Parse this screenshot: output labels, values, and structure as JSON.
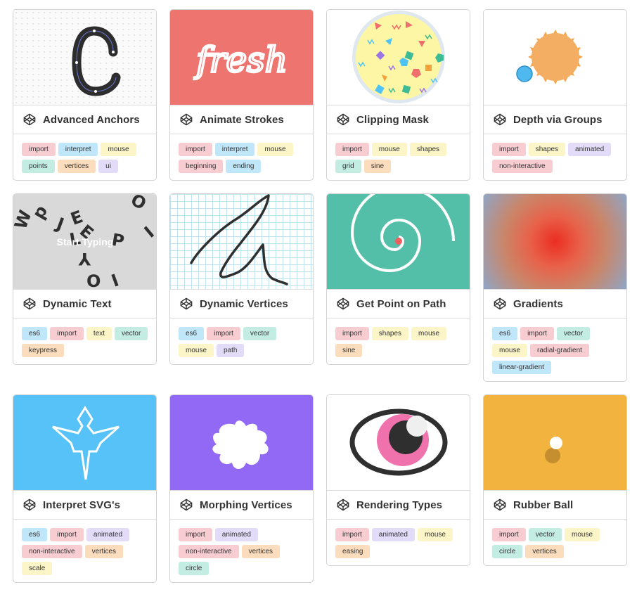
{
  "cards": [
    {
      "title": "Advanced Anchors",
      "tags": [
        "import",
        "interpret",
        "mouse",
        "points",
        "vertices",
        "ui"
      ]
    },
    {
      "title": "Animate Strokes",
      "tags": [
        "import",
        "interpret",
        "mouse",
        "beginning",
        "ending"
      ],
      "art_text": "fresh"
    },
    {
      "title": "Clipping Mask",
      "tags": [
        "import",
        "mouse",
        "shapes",
        "grid",
        "sine"
      ]
    },
    {
      "title": "Depth via Groups",
      "tags": [
        "import",
        "shapes",
        "animated",
        "non-interactive"
      ]
    },
    {
      "title": "Dynamic Text",
      "tags": [
        "es6",
        "import",
        "text",
        "vector",
        "keypress"
      ],
      "art_text": "Start Typing"
    },
    {
      "title": "Dynamic Vertices",
      "tags": [
        "es6",
        "import",
        "vector",
        "mouse",
        "path"
      ]
    },
    {
      "title": "Get Point on Path",
      "tags": [
        "import",
        "shapes",
        "mouse",
        "sine"
      ]
    },
    {
      "title": "Gradients",
      "tags": [
        "es6",
        "import",
        "vector",
        "mouse",
        "radial-gradient",
        "linear-gradient"
      ]
    },
    {
      "title": "Interpret SVG's",
      "tags": [
        "es6",
        "import",
        "animated",
        "non-interactive",
        "vertices",
        "scale"
      ]
    },
    {
      "title": "Morphing Vertices",
      "tags": [
        "import",
        "animated",
        "non-interactive",
        "vertices",
        "circle"
      ]
    },
    {
      "title": "Rendering Types",
      "tags": [
        "import",
        "animated",
        "mouse",
        "easing"
      ]
    },
    {
      "title": "Rubber Ball",
      "tags": [
        "import",
        "vector",
        "mouse",
        "circle",
        "vertices"
      ]
    }
  ],
  "tag_colors": {
    "import": "#f7cdd2",
    "interpret": "#bfe6f9",
    "mouse": "#fbf5c8",
    "points": "#c3ece3",
    "vertices": "#fbdcbc",
    "ui": "#e3dcf9",
    "beginning": "#f7cdd2",
    "ending": "#bfe6f9",
    "shapes": "#fbf5c8",
    "grid": "#c3ece3",
    "sine": "#fbdcbc",
    "animated": "#e3dcf9",
    "non-interactive": "#f7cdd2",
    "es6": "#bfe6f9",
    "text": "#fbf5c8",
    "vector": "#c3ece3",
    "keypress": "#fbdcbc",
    "path": "#e3dcf9",
    "radial-gradient": "#f7cdd2",
    "linear-gradient": "#bfe6f9",
    "scale": "#fbf5c8",
    "circle": "#c3ece3",
    "easing": "#fbdcbc"
  },
  "icons": {
    "title_icon": "codepen-icon"
  }
}
